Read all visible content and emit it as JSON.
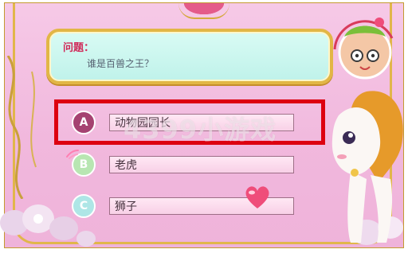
{
  "question": {
    "label": "问题：",
    "text": "谁是百兽之王？"
  },
  "answers": [
    {
      "letter": "A",
      "text": "动物园园长"
    },
    {
      "letter": "B",
      "text": "老虎"
    },
    {
      "letter": "C",
      "text": "狮子"
    }
  ],
  "watermark": "4399小游戏",
  "logo": {
    "text": "4399奥比岛·青蛙"
  },
  "highlighted_answer": "A",
  "colors": {
    "background_pink": "#f1b8dd",
    "panel_mint": "#c7f4ec",
    "gold_border": "#e1b64a",
    "highlight_red": "#dd0010",
    "badge_a": "#a33c6d",
    "badge_b": "#b8e6b2",
    "badge_c": "#aee6e6"
  }
}
